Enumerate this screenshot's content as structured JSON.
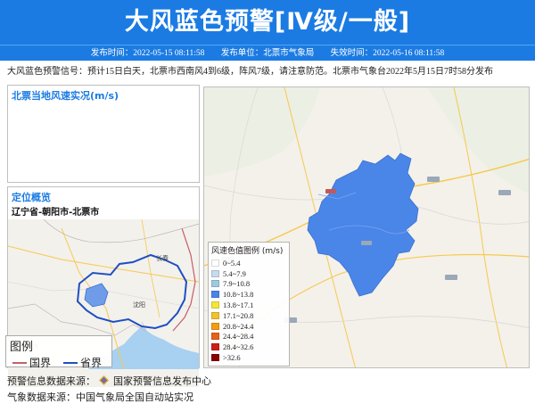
{
  "header": {
    "title": "大风蓝色预警[Ⅳ级/一般]",
    "publish_time_label": "发布时间：",
    "publish_time": "2022-05-15 08:11:58",
    "publisher_label": "发布单位：",
    "publisher": "北票市气象局",
    "expire_label": "失效时间：",
    "expire_time": "2022-05-16 08:11:58"
  },
  "signal_text": "大风蓝色预警信号：预计15日白天，北票市西南风4到6级，阵风7级，请注意防范。北票市气象台2022年5月15日7时58分发布",
  "wind_box": {
    "title": "北票当地风速实况(m/s)"
  },
  "location_box": {
    "title": "定位概览",
    "subtitle": "辽宁省-朝阳市-北票市",
    "city_labels": [
      "长春",
      "沈阳",
      "北京"
    ]
  },
  "small_legend": {
    "title": "图例",
    "items": [
      {
        "label": "国界",
        "color": "#c65e6b"
      },
      {
        "label": "省界",
        "color": "#1f4fc4"
      }
    ]
  },
  "wind_legend": {
    "title": "风速色值图例 (m/s)",
    "items": [
      {
        "label": "0~5.4",
        "color": "#ffffff"
      },
      {
        "label": "5.4~7.9",
        "color": "#c6dbef"
      },
      {
        "label": "7.9~10.8",
        "color": "#9ecae1"
      },
      {
        "label": "10.8~13.8",
        "color": "#4a86e8"
      },
      {
        "label": "13.8~17.1",
        "color": "#f5e53b"
      },
      {
        "label": "17.1~20.8",
        "color": "#f2c12e"
      },
      {
        "label": "20.8~24.4",
        "color": "#f39c12"
      },
      {
        "label": "24.4~28.4",
        "color": "#e8611a"
      },
      {
        "label": "28.4~32.6",
        "color": "#cc1f1a"
      },
      {
        "label": ">32.6",
        "color": "#8b0000"
      }
    ]
  },
  "footer": {
    "warning_source": "预警信息数据来源：",
    "warning_source_name": "国家预警信息发布中心",
    "weather_source": "气象数据来源：中国气象局全国自动站实况"
  },
  "colors": {
    "header_bg": "#1b7be3",
    "region_fill": "#4a86e8",
    "title_blue": "#1b7be3"
  }
}
